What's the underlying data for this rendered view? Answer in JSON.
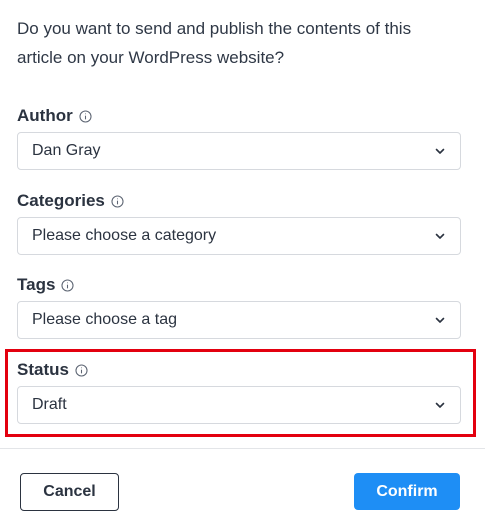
{
  "dialog": {
    "intro_text": "Do you want to send and publish the contents of this article on your WordPress website?"
  },
  "fields": {
    "author": {
      "label": "Author",
      "value": "Dan Gray"
    },
    "categories": {
      "label": "Categories",
      "value": "Please choose a category"
    },
    "tags": {
      "label": "Tags",
      "value": "Please choose a tag"
    },
    "status": {
      "label": "Status",
      "value": "Draft"
    }
  },
  "footer": {
    "cancel_label": "Cancel",
    "confirm_label": "Confirm"
  },
  "icons": {
    "info": "info-circle-icon",
    "dropdown": "chevron-down-icon"
  },
  "colors": {
    "primary": "#1e8ef5",
    "highlight": "#e3000f",
    "text": "#2b3340",
    "border": "#d6d9de"
  }
}
